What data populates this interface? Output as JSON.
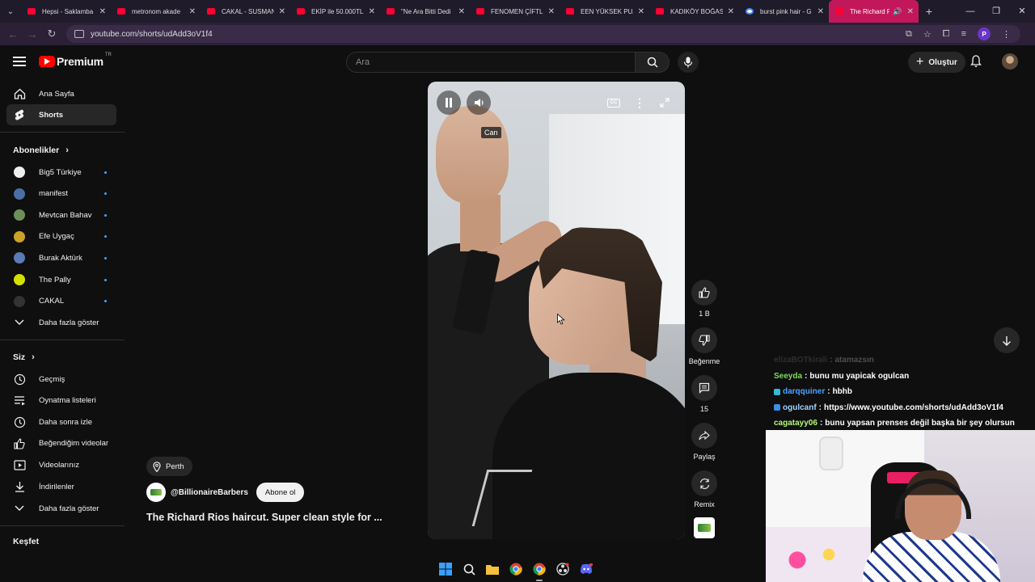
{
  "browser": {
    "tabs": [
      {
        "title": "Hepsi - Saklamba",
        "favicon": "youtube-favicon"
      },
      {
        "title": "metronom akade",
        "favicon": "youtube-favicon"
      },
      {
        "title": "CAKAL - SUSMAN",
        "favicon": "youtube-favicon"
      },
      {
        "title": "EKİP ile 50.000TL",
        "favicon": "youtube-favicon"
      },
      {
        "title": "\"Ne Ara Bitti Dedi",
        "favicon": "youtube-favicon"
      },
      {
        "title": "FENOMEN ÇİFTLİK",
        "favicon": "youtube-favicon"
      },
      {
        "title": "EEN YÜKSEK PUA",
        "favicon": "youtube-favicon"
      },
      {
        "title": "KADIKÖY BOĞASI",
        "favicon": "youtube-favicon"
      },
      {
        "title": "burst pink hair - G",
        "favicon": "google-favicon"
      },
      {
        "title": "The Richard R",
        "favicon": "youtube-favicon",
        "active": true
      }
    ],
    "url": "youtube.com/shorts/udAdd3oV1f4",
    "profile_initial": "P"
  },
  "header": {
    "logo_text": "Premium",
    "logo_country": "TR",
    "search_placeholder": "Ara",
    "create_label": "Oluştur"
  },
  "sidebar": {
    "main": [
      {
        "label": "Ana Sayfa",
        "icon": "home-icon"
      },
      {
        "label": "Shorts",
        "icon": "shorts-icon",
        "active": true
      }
    ],
    "subscriptions_title": "Abonelikler",
    "subscriptions": [
      {
        "label": "Big5 Türkiye",
        "color": "#eeeeee"
      },
      {
        "label": "manifest",
        "color": "#4a6fa5"
      },
      {
        "label": "Mevtcan Bahav",
        "color": "#6d8f5a"
      },
      {
        "label": "Efe Uygaç",
        "color": "#c9a227"
      },
      {
        "label": "Burak Aktürk",
        "color": "#5b7bb4"
      },
      {
        "label": "The Pally",
        "color": "#d4e000"
      },
      {
        "label": "CAKAL",
        "color": "#333333"
      }
    ],
    "show_more_1": "Daha fazla göster",
    "you_title": "Siz",
    "you_items": [
      {
        "label": "Geçmiş",
        "icon": "history-icon"
      },
      {
        "label": "Oynatma listeleri",
        "icon": "playlists-icon"
      },
      {
        "label": "Daha sonra izle",
        "icon": "watch-later-icon"
      },
      {
        "label": "Beğendiğim videolar",
        "icon": "liked-icon"
      },
      {
        "label": "Videolarınız",
        "icon": "your-videos-icon"
      },
      {
        "label": "İndirilenler",
        "icon": "downloads-icon"
      }
    ],
    "show_more_2": "Daha fazla göster",
    "explore_title": "Keşfet"
  },
  "short": {
    "caption_tag": "Can",
    "location": "Perth",
    "channel": "@BillionaireBarbers",
    "subscribe_label": "Abone ol",
    "title": "The Richard Rios haircut. Super clean style for ..."
  },
  "actions": {
    "likes": "1 B",
    "dislike_label": "Beğenme",
    "comments": "15",
    "share_label": "Paylaş",
    "remix_label": "Remix"
  },
  "chat": [
    {
      "user": "elizaBOTkirali",
      "message": "atamazsın",
      "color": "#888888",
      "faded": true
    },
    {
      "user": "Seeyda",
      "message": "bunu mu yapicak ogulcan",
      "color": "#7ddc5a"
    },
    {
      "user": "darqquiner",
      "message": "hbhb",
      "color": "#4aa3ff",
      "badge": "#3ab8d8"
    },
    {
      "user": "ogulcanf",
      "message": "https://www.youtube.com/shorts/udAdd3oV1f4",
      "color": "#9fd3ff",
      "badge": "#3a8ee6"
    },
    {
      "user": "cagatayy06",
      "message": "bunu yapsan prenses değil başka bir şey olursun",
      "color": "#b4f57a"
    }
  ],
  "colors": {
    "accent_tab": "#c2185b",
    "yt_red": "#ff0000",
    "sub_dot": "#3ea6ff"
  }
}
